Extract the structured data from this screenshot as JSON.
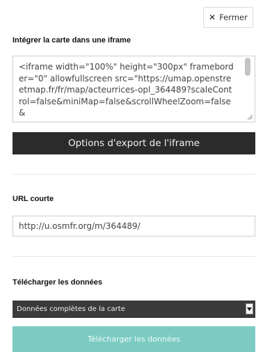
{
  "close_button": {
    "icon": "close-icon",
    "label": "Fermer"
  },
  "iframe_section": {
    "title": "Intégrer la carte dans une iframe",
    "code": "<iframe width=\"100%\" height=\"300px\" frameborder=\"0\" allowfullscreen src=\"https://umap.openstreetmap.fr/fr/map/acteurrices-opl_364489?scaleControl=false&miniMap=false&scrollWheelZoom=false&",
    "export_options_label": "Options d'export de l'iframe"
  },
  "short_url_section": {
    "title": "URL courte",
    "value": "http://u.osmfr.org/m/364489/"
  },
  "download_section": {
    "title": "Télécharger les données",
    "selected_option": "Données complètes de la carte",
    "download_label": "Télécharger les données"
  },
  "colors": {
    "dark_button": "#2b2b2b",
    "select_bg": "#3a3a3a",
    "download_button": "#7ccbc3"
  }
}
